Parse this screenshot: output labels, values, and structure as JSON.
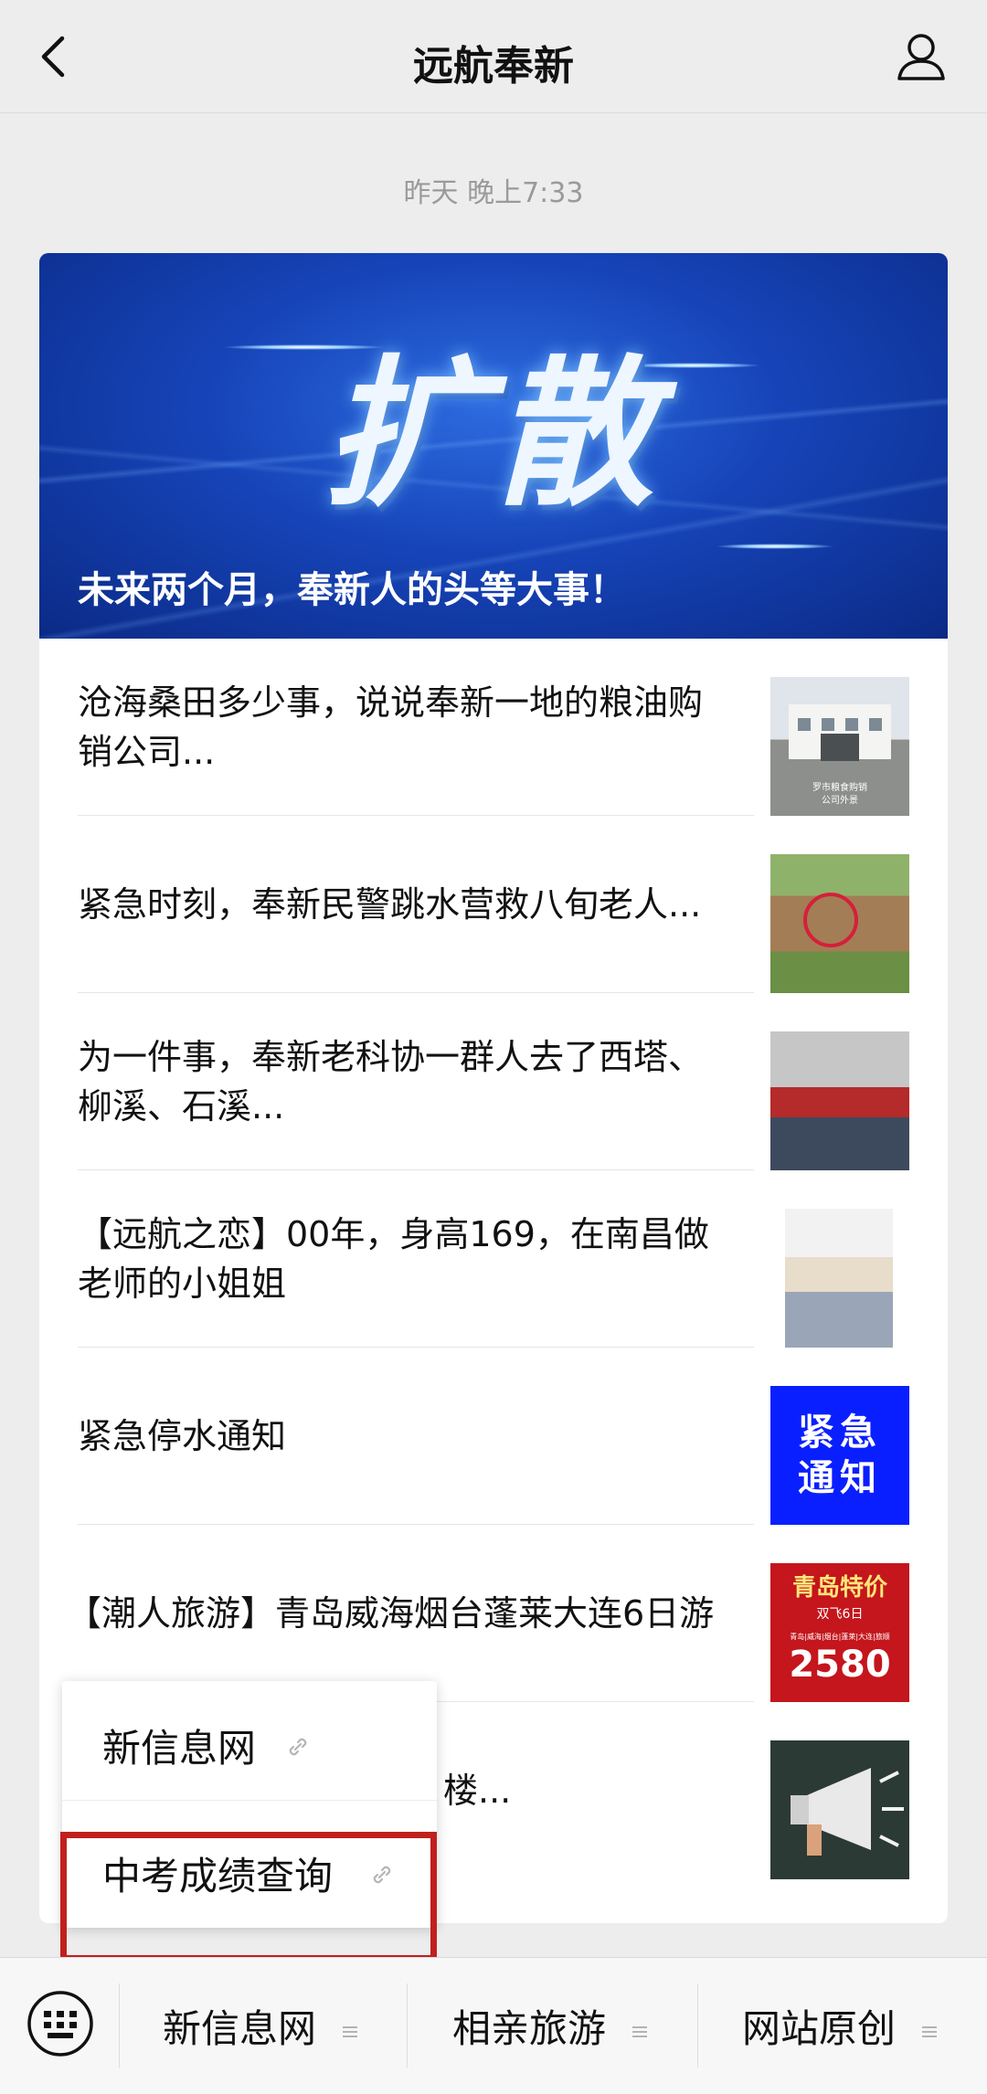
{
  "header": {
    "back_icon": "chevron-left-icon",
    "title": "远航奉新",
    "profile_icon": "person-icon"
  },
  "timestamp": "昨天 晚上7:33",
  "hero": {
    "big_text": "扩散",
    "caption": "未来两个月，奉新人的头等大事！"
  },
  "articles": [
    {
      "title": "沧海桑田多少事，说说奉新一地的粮油购销公司...",
      "thumb_caption": "罗市粮食购销公司外景"
    },
    {
      "title": "紧急时刻，奉新民警跳水营救八旬老人..."
    },
    {
      "title": "为一件事，奉新老科协一群人去了西塔、柳溪、石溪..."
    },
    {
      "title": "【远航之恋】00年，身高169，在南昌做老师的小姐姐"
    },
    {
      "title": "紧急停水通知",
      "thumb_text_1": "紧急",
      "thumb_text_2": "通知"
    },
    {
      "title": "【潮人旅游】青岛威海烟台蓬莱大连6日游",
      "thumb_line_1": "青岛特价",
      "thumb_line_2": "双飞6日",
      "thumb_line_3": "青岛|威海|烟台|蓬莱|大连|旅顺",
      "thumb_line_4": "2580"
    },
    {
      "title": "楼..."
    }
  ],
  "popup_menu": {
    "items": [
      {
        "label": "新信息网",
        "icon": "link-icon"
      },
      {
        "label": "中考成绩查询",
        "icon": "link-icon"
      }
    ],
    "highlight_color": "#c1201d"
  },
  "bottom_bar": {
    "keyboard_icon": "keyboard-icon",
    "tabs": [
      {
        "label": "新信息网",
        "icon": "menu-lines-icon"
      },
      {
        "label": "相亲旅游",
        "icon": "menu-lines-icon"
      },
      {
        "label": "网站原创",
        "icon": "menu-lines-icon"
      }
    ]
  },
  "colors": {
    "background": "#ededed",
    "hero_blue": "#1644b8",
    "highlight_red": "#c1201d"
  }
}
